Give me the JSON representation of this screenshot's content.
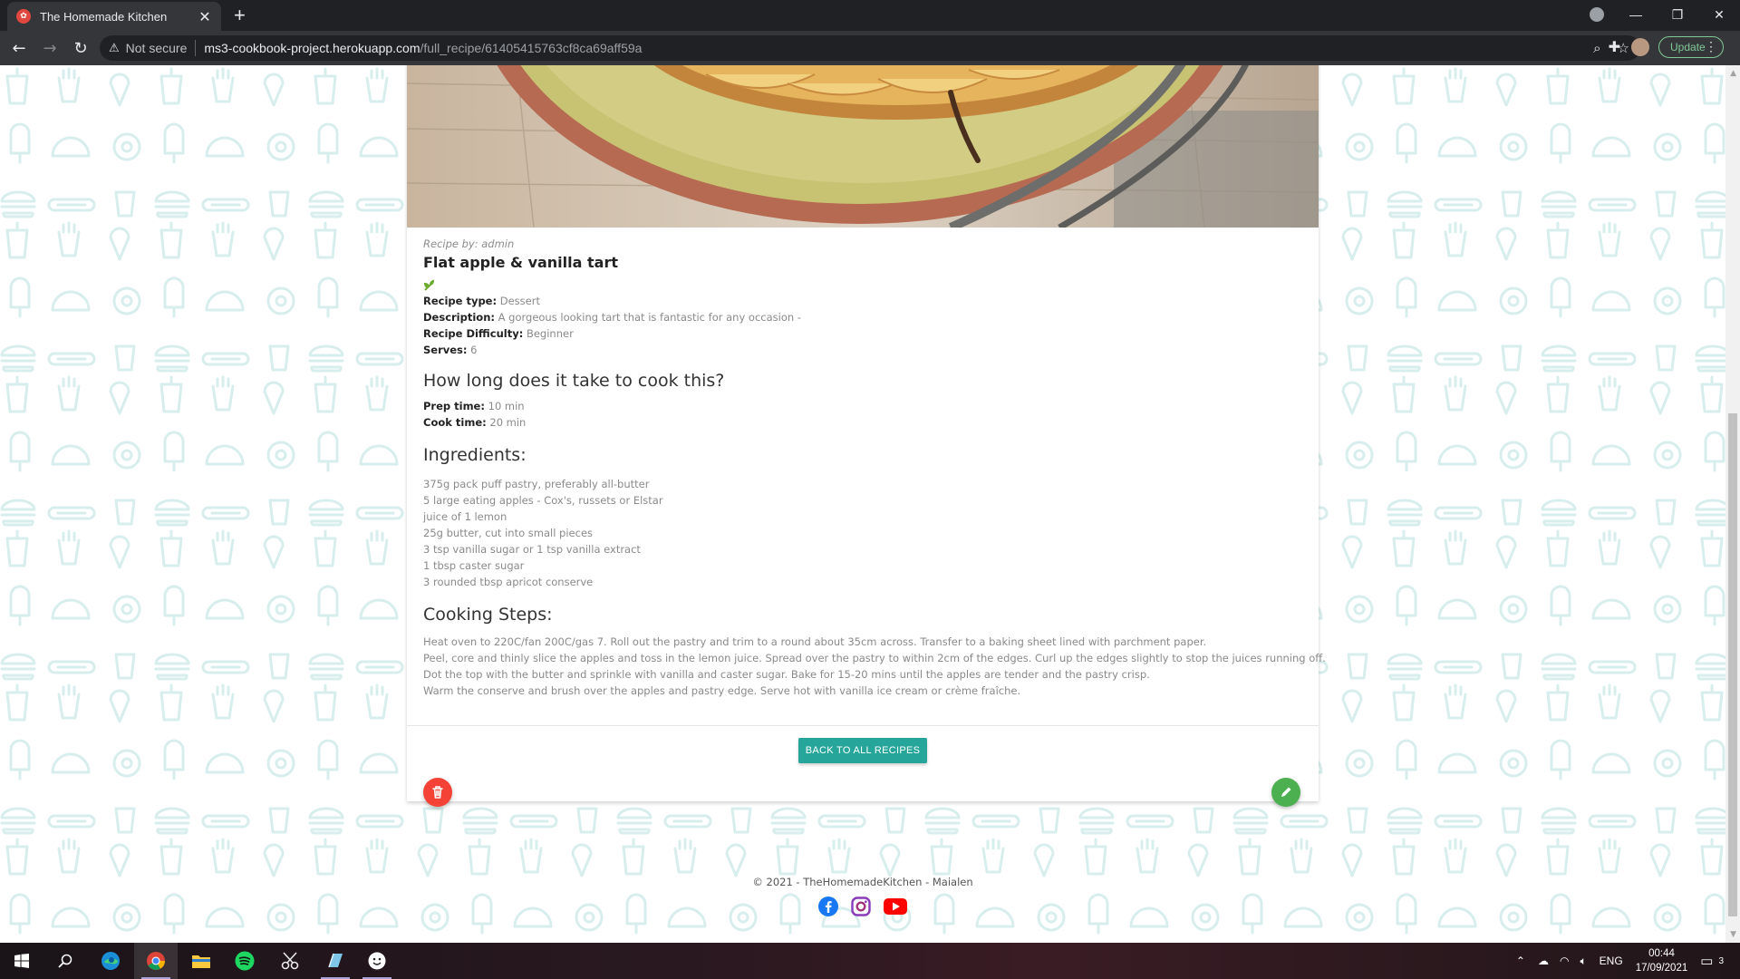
{
  "browser": {
    "tab_title": "The Homemade Kitchen",
    "not_secure": "Not secure",
    "url_host": "ms3-cookbook-project.herokuapp.com",
    "url_path": "/full_recipe/61405415763cf8ca69aff59a",
    "update_label": "Update"
  },
  "recipe": {
    "author_line": "Recipe by: admin",
    "title": "Flat apple & vanilla tart",
    "type_label": "Recipe type:",
    "type_value": "Dessert",
    "description_label": "Description:",
    "description_value": "A gorgeous looking tart that is fantastic for any occasion -",
    "difficulty_label": "Recipe Difficulty:",
    "difficulty_value": "Beginner",
    "serves_label": "Serves:",
    "serves_value": "6",
    "cook_heading": "How long does it take to cook this?",
    "prep_label": "Prep time:",
    "prep_value": "10 min",
    "cooktime_label": "Cook time:",
    "cooktime_value": "20 min",
    "ingredients_heading": "Ingredients:",
    "ingredients": [
      "375g pack puff pastry, preferably all-butter",
      "5 large eating apples - Cox's, russets or Elstar",
      "juice of 1 lemon",
      "25g butter, cut into small pieces",
      "3 tsp vanilla sugar or 1 tsp vanilla extract",
      "1 tbsp caster sugar",
      "3 rounded tbsp apricot conserve"
    ],
    "steps_heading": "Cooking Steps:",
    "steps": [
      "Heat oven to 220C/fan 200C/gas 7. Roll out the pastry and trim to a round about 35cm across. Transfer to a baking sheet lined with parchment paper.",
      "Peel, core and thinly slice the apples and toss in the lemon juice. Spread over the pastry to within 2cm of the edges. Curl up the edges slightly to stop the juices running off.",
      "Dot the top with the butter and sprinkle with vanilla and caster sugar. Bake for 15-20 mins until the apples are tender and the pastry crisp.",
      "Warm the conserve and brush over the apples and pastry edge. Serve hot with vanilla ice cream or crème fraîche."
    ],
    "back_button": "BACK TO ALL RECIPES"
  },
  "footer": {
    "copyright": "© 2021 - TheHomemadeKitchen - Maialen"
  },
  "taskbar": {
    "language": "ENG",
    "time": "00:44",
    "date": "17/09/2021",
    "notification_count": "3"
  },
  "colors": {
    "accent_teal": "#26a69a",
    "delete_red": "#f44336",
    "edit_green": "#4caf50",
    "pattern_tint": "#d7eeed"
  },
  "icons": [
    "warning-icon",
    "search-icon",
    "star-icon",
    "puzzle-icon",
    "sprout-icon",
    "trash-icon",
    "pencil-icon",
    "facebook-icon",
    "instagram-icon",
    "youtube-icon",
    "windows-start-icon"
  ]
}
